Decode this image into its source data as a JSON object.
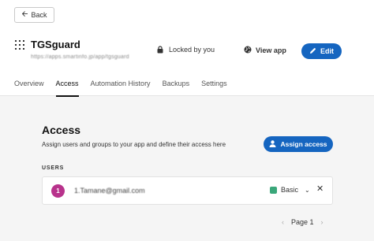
{
  "header": {
    "back_label": "Back",
    "app_title": "TGSguard",
    "app_url": "https://apps.smartinfo.jp/app/tgsguard",
    "locked_label": "Locked by you",
    "view_app_label": "View app",
    "edit_label": "Edit"
  },
  "tabs": [
    {
      "label": "Overview"
    },
    {
      "label": "Access",
      "active": true
    },
    {
      "label": "Automation History"
    },
    {
      "label": "Backups"
    },
    {
      "label": "Settings"
    }
  ],
  "access": {
    "title": "Access",
    "description": "Assign users and groups to your app and define their access here",
    "assign_label": "Assign access",
    "users_label": "USERS",
    "users": [
      {
        "avatar_text": "1",
        "email": "1.Tamane@gmail.com",
        "role": "Basic"
      }
    ]
  },
  "pager": {
    "label": "Page 1"
  },
  "colors": {
    "primary": "#1565c0",
    "avatar": "#b8338c",
    "role_basic": "#3aa77a"
  }
}
